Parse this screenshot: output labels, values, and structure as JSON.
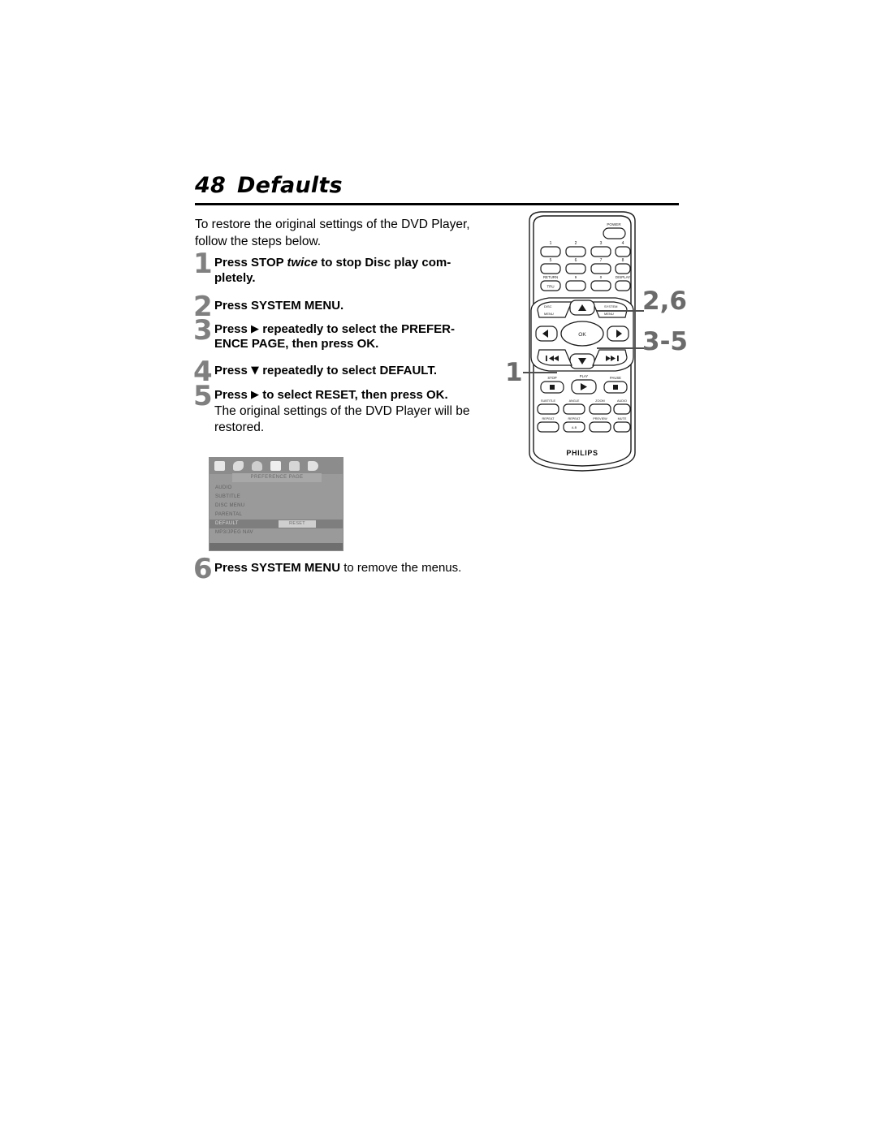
{
  "page": {
    "heading_number": "48",
    "heading_title": "Defaults",
    "intro": "To restore the original settings of the DVD Player, follow the steps below."
  },
  "steps": [
    {
      "number": "1",
      "parts": [
        {
          "text": "Press ",
          "style": "bold"
        },
        {
          "text": "STOP ",
          "style": "bold"
        },
        {
          "text": "twice",
          "style": "bold-italic"
        },
        {
          "text": " to stop Disc play completely.",
          "style": "bold"
        }
      ],
      "plain": "Press STOP twice to stop Disc play completely."
    },
    {
      "number": "2",
      "parts": [
        {
          "text": "Press ",
          "style": "bold"
        },
        {
          "text": "SYSTEM MENU",
          "style": "bold"
        },
        {
          "text": ".",
          "style": "bold"
        }
      ],
      "plain": "Press SYSTEM MENU."
    },
    {
      "number": "3",
      "parts": [
        {
          "text": "Press ",
          "style": "bold"
        },
        {
          "text": "▶",
          "style": "glyph"
        },
        {
          "text": " repeatedly to select the ",
          "style": "bold"
        },
        {
          "text": "PREFERENCE PAGE",
          "style": "bold"
        },
        {
          "text": ", then press ",
          "style": "bold"
        },
        {
          "text": "OK",
          "style": "bold"
        },
        {
          "text": ".",
          "style": "bold"
        }
      ],
      "plain": "Press ▶ repeatedly to select the PREFERENCE PAGE, then press OK."
    },
    {
      "number": "4",
      "parts": [
        {
          "text": "Press ",
          "style": "bold"
        },
        {
          "text": "▼",
          "style": "glyph"
        },
        {
          "text": " repeatedly to select ",
          "style": "bold"
        },
        {
          "text": "DEFAULT",
          "style": "bold"
        },
        {
          "text": ".",
          "style": "bold"
        }
      ],
      "plain": "Press ▼ repeatedly to select DEFAULT."
    },
    {
      "number": "5",
      "parts": [
        {
          "text": "Press ",
          "style": "bold"
        },
        {
          "text": "▶",
          "style": "glyph"
        },
        {
          "text": " to select ",
          "style": "bold"
        },
        {
          "text": "RESET",
          "style": "bold"
        },
        {
          "text": ", then press ",
          "style": "bold"
        },
        {
          "text": "OK",
          "style": "bold"
        },
        {
          "text": ".",
          "style": "bold"
        }
      ],
      "plain": "Press ▶ to select RESET, then press OK.",
      "sub": "The original settings of the DVD Player will be restored."
    },
    {
      "number": "6",
      "parts": [
        {
          "text": "Press ",
          "style": "bold"
        },
        {
          "text": "SYSTEM MENU",
          "style": "bold"
        },
        {
          "text": " to remove the menus.",
          "style": "normal"
        }
      ],
      "plain": "Press SYSTEM MENU to remove the menus."
    }
  ],
  "step_labels": {
    "s1_a": "Press ",
    "s1_stop": "STOP ",
    "s1_twice": "twice",
    "s1_b": " to stop Disc play com-",
    "s1_c": "pletely.",
    "s2_a": "Press ",
    "s2_b": "SYSTEM MENU.",
    "s3_a": "Press ",
    "s3_arrow": "▶",
    "s3_b": " repeatedly to select the ",
    "s3_c": "PREFER-",
    "s3_d": "ENCE PAGE",
    "s3_e": ", then press ",
    "s3_f": "OK",
    "s3_g": ".",
    "s4_a": "Press ",
    "s4_arrow": "▼",
    "s4_b": " repeatedly to select ",
    "s4_c": "DEFAULT",
    "s4_d": ".",
    "s5_a": "Press ",
    "s5_arrow": "▶",
    "s5_b": " to select ",
    "s5_c": "RESET",
    "s5_d": ", then press ",
    "s5_e": "OK",
    "s5_f": ".",
    "s5_sub": "The original settings of the DVD Player will be restored.",
    "s6_a": "Press ",
    "s6_b": "SYSTEM MENU",
    "s6_c": " to remove the menus."
  },
  "osd": {
    "title": "PREFERENCE PAGE",
    "rows": [
      {
        "label": "AUDIO",
        "value": ""
      },
      {
        "label": "SUBTITLE",
        "value": ""
      },
      {
        "label": "DISC MENU",
        "value": ""
      },
      {
        "label": "PARENTAL",
        "value": ""
      },
      {
        "label": "DEFAULT",
        "value": "RESET",
        "selected": true
      },
      {
        "label": "MP3/JPEG NAV",
        "value": ""
      }
    ],
    "icons": [
      "screen-icon",
      "audio-icon",
      "video-icon",
      "preference-icon",
      "lock-icon",
      "exit-icon"
    ]
  },
  "remote": {
    "brand": "PHILIPS",
    "power_label": "POWER",
    "keypad": [
      [
        "1",
        "2",
        "3",
        "4"
      ],
      [
        "5",
        "6",
        "7",
        "8"
      ]
    ],
    "keypad_row3": [
      {
        "top": "RETURN",
        "label": "TRU"
      },
      {
        "top": "",
        "label": "9"
      },
      {
        "top": "",
        "label": "0"
      },
      {
        "top": "DISPLAY",
        "label": ""
      }
    ],
    "nav": {
      "disc_menu": "DISC MENU",
      "system_menu": "SYSTEM MENU",
      "ok": "OK",
      "up": "▲",
      "down": "▼",
      "left": "◀",
      "right": "▶",
      "prev": "⏮",
      "next": "⏭"
    },
    "transport": [
      {
        "label": "STOP",
        "glyph": "■"
      },
      {
        "label": "PLAY",
        "glyph": "▶"
      },
      {
        "label": "PAUSE",
        "glyph": "■"
      }
    ],
    "function_row1": [
      "SUBTITLE",
      "ANGLE",
      "ZOOM",
      "AUDIO"
    ],
    "function_row2": [
      "REPEAT",
      "REPEAT A-B",
      "PREVIEW",
      "MUTE"
    ],
    "callouts": [
      {
        "id": "callout-1",
        "text": "1"
      },
      {
        "id": "callout-26",
        "text": "2,6"
      },
      {
        "id": "callout-35",
        "text": "3-5"
      }
    ]
  },
  "colors": {
    "step_number_gray": "#808080",
    "callout_gray": "#6b6b6b",
    "osd_bg": "#9a9a9a",
    "osd_selected": "#7e7e7e",
    "rule_black": "#000000"
  }
}
